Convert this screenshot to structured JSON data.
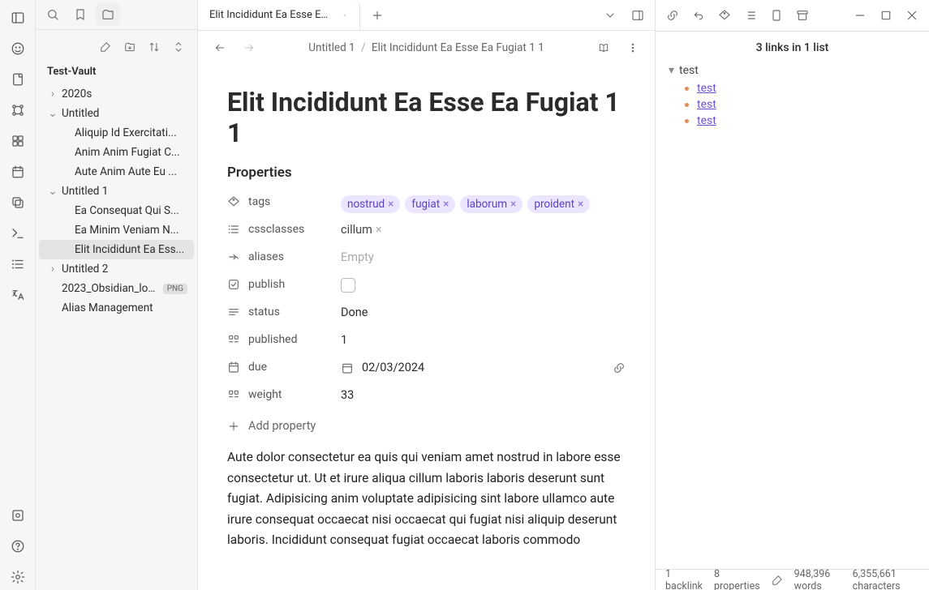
{
  "vault": {
    "name": "Test-Vault"
  },
  "tree": {
    "items": [
      {
        "label": "2020s",
        "type": "folder",
        "open": false,
        "depth": 0
      },
      {
        "label": "Untitled",
        "type": "folder",
        "open": true,
        "depth": 0
      },
      {
        "label": "Aliquip Id Exercitati...",
        "type": "file",
        "depth": 1
      },
      {
        "label": "Anim Anim Fugiat C...",
        "type": "file",
        "depth": 1
      },
      {
        "label": "Aute Anim Aute Eu ...",
        "type": "file",
        "depth": 1
      },
      {
        "label": "Untitled 1",
        "type": "folder",
        "open": true,
        "depth": 0
      },
      {
        "label": "Ea Consequat Qui S...",
        "type": "file",
        "depth": 1
      },
      {
        "label": "Ea Minim Veniam N...",
        "type": "file",
        "depth": 1
      },
      {
        "label": "Elit Incididunt Ea Ess...",
        "type": "file",
        "depth": 1,
        "active": true
      },
      {
        "label": "Untitled 2",
        "type": "folder",
        "open": false,
        "depth": 0
      },
      {
        "label": "2023_Obsidian_lo...",
        "type": "file",
        "depth": 0,
        "ext": "PNG"
      },
      {
        "label": "Alias Management",
        "type": "file",
        "depth": 0
      }
    ]
  },
  "tabs": {
    "open": [
      {
        "label": "Elit Incididunt Ea Esse Ea F..."
      }
    ]
  },
  "breadcrumb": {
    "parent": "Untitled 1",
    "current": "Elit Incididunt Ea Esse Ea Fugiat 1 1"
  },
  "doc": {
    "title": "Elit Incididunt Ea Esse Ea Fugiat 1 1",
    "props_heading": "Properties",
    "props": {
      "tags": {
        "label": "tags",
        "values": [
          "nostrud",
          "fugiat",
          "laborum",
          "proident"
        ]
      },
      "cssclasses": {
        "label": "cssclasses",
        "values": [
          "cillum"
        ]
      },
      "aliases": {
        "label": "aliases",
        "empty": "Empty"
      },
      "publish": {
        "label": "publish",
        "checked": false
      },
      "status": {
        "label": "status",
        "value": "Done"
      },
      "published": {
        "label": "published",
        "value": "1"
      },
      "due": {
        "label": "due",
        "value": "02/03/2024"
      },
      "weight": {
        "label": "weight",
        "value": "33"
      }
    },
    "add_property": "Add property",
    "body": "Aute dolor consectetur ea quis qui veniam amet nostrud in labore esse\nconsectetur ut. Ut et irure aliqua cillum laboris laboris deserunt sunt fugiat. Adipisicing anim voluptate adipisicing sint labore ullamco aute\nirure consequat occaecat nisi occaecat qui fugiat nisi aliquip deserunt\nlaboris. Incididunt consequat fugiat occaecat laboris commodo"
  },
  "rightpane": {
    "title": "3 links in 1 list",
    "group": "test",
    "links": [
      "test",
      "test",
      "test"
    ]
  },
  "status": {
    "backlinks": "1 backlink",
    "properties": "8 properties",
    "words": "948,396 words",
    "chars": "6,355,661 characters"
  }
}
